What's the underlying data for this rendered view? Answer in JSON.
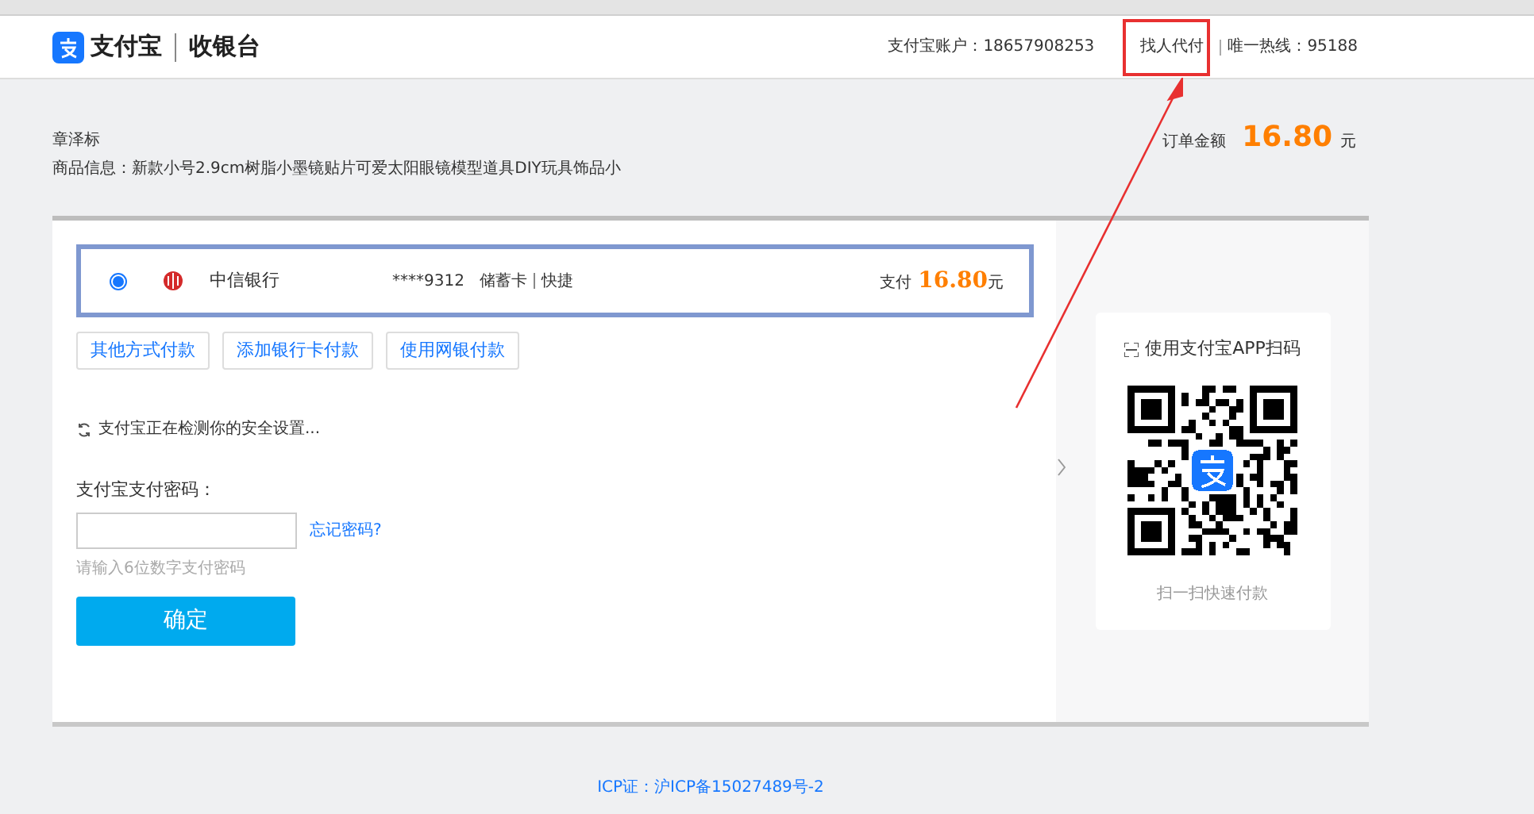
{
  "header": {
    "logo_text": "支付宝",
    "title": "收银台",
    "account_label": "支付宝账户：",
    "account": "18657908253",
    "find_payer": "找人代付",
    "hotline": "唯一热线：95188"
  },
  "order": {
    "payer": "章泽标",
    "product": "商品信息：新款小号2.9cm树脂小墨镜贴片可爱太阳眼镜模型道具DIY玩具饰品小",
    "amount_label": "订单金额",
    "amount": "16.80",
    "currency": "元"
  },
  "payment_method": {
    "selected": true,
    "bank": "中信银行",
    "card": "****9312",
    "card_type": "储蓄卡",
    "channel": "快捷",
    "pay_label": "支付",
    "amount": "16.80",
    "currency": "元"
  },
  "alt_buttons": [
    "其他方式付款",
    "添加银行卡付款",
    "使用网银付款"
  ],
  "security_note": "支付宝正在检测你的安全设置...",
  "password": {
    "label": "支付宝支付密码：",
    "forgot_link": "忘记密码?",
    "hint": "请输入6位数字支付密码"
  },
  "confirm_button": "确定",
  "qr": {
    "title": "使用支付宝APP扫码",
    "caption": "扫一扫快速付款"
  },
  "footer": "ICP证：沪ICP备15027489号-2"
}
